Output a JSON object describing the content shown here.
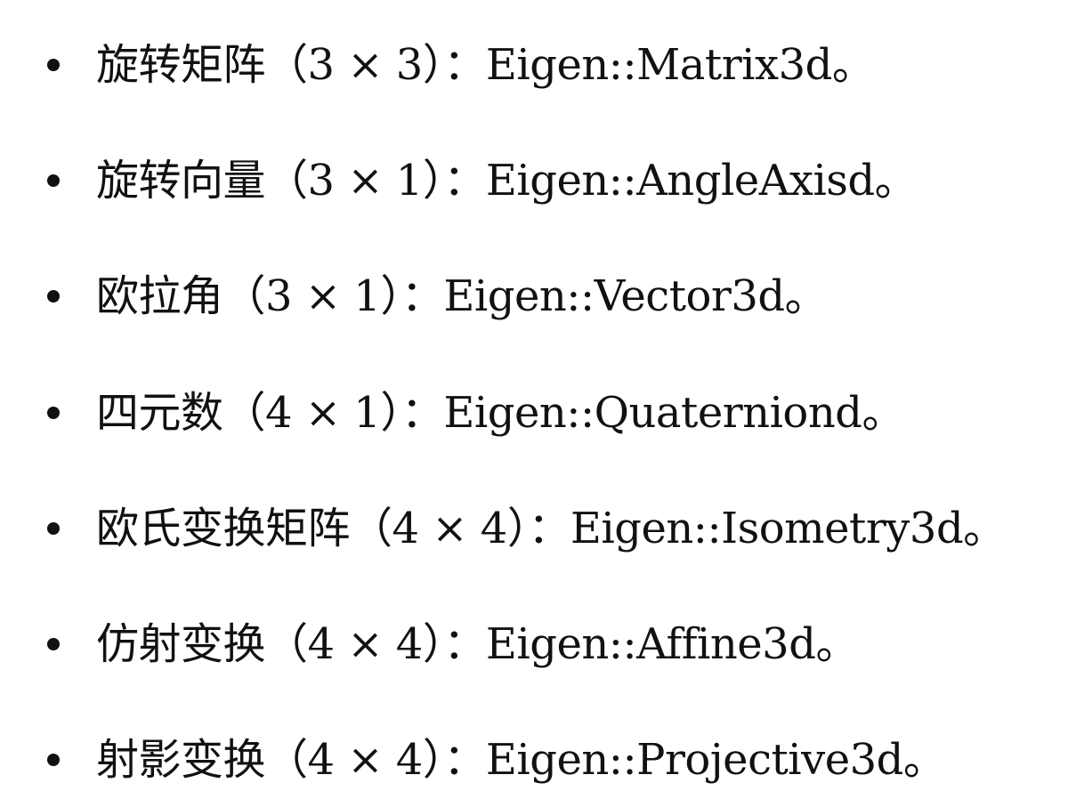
{
  "list": {
    "items": [
      {
        "label": "旋转矩阵",
        "open_paren": "（",
        "dims": "3 × 3",
        "close_colon": "）：",
        "type": "Eigen::Matrix3d",
        "end": "。"
      },
      {
        "label": "旋转向量",
        "open_paren": "（",
        "dims": "3 × 1",
        "close_colon": "）：",
        "type": "Eigen::AngleAxisd",
        "end": "。"
      },
      {
        "label": "欧拉角",
        "open_paren": "（",
        "dims": "3 × 1",
        "close_colon": "）：",
        "type": "Eigen::Vector3d",
        "end": "。"
      },
      {
        "label": "四元数",
        "open_paren": "（",
        "dims": "4 × 1",
        "close_colon": "）：",
        "type": "Eigen::Quaterniond",
        "end": "。"
      },
      {
        "label": "欧氏变换矩阵",
        "open_paren": "（",
        "dims": "4 × 4",
        "close_colon": "）：",
        "type": "Eigen::Isometry3d",
        "end": "。"
      },
      {
        "label": "仿射变换",
        "open_paren": "（",
        "dims": "4 × 4",
        "close_colon": "）：",
        "type": "Eigen::Affine3d",
        "end": "。"
      },
      {
        "label": "射影变换",
        "open_paren": "（",
        "dims": "4 × 4",
        "close_colon": "）：",
        "type": "Eigen::Projective3d",
        "end": "。"
      }
    ]
  }
}
